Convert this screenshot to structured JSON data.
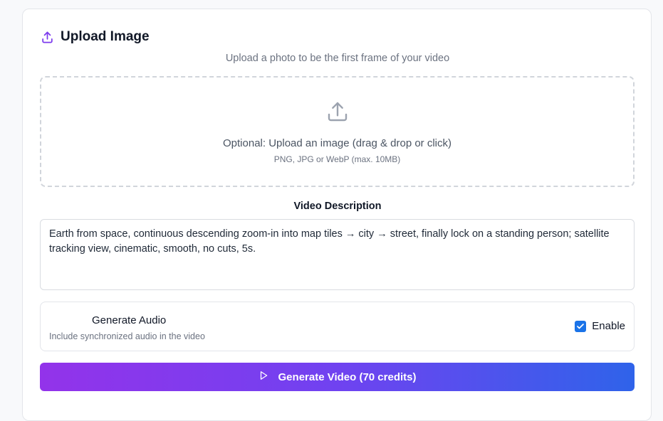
{
  "upload": {
    "title": "Upload Image",
    "subtitle": "Upload a photo to be the first frame of your video",
    "dropzone_text": "Optional: Upload an image (drag & drop or click)",
    "dropzone_hint": "PNG, JPG or WebP (max. 10MB)",
    "icon": "upload-icon"
  },
  "description": {
    "label": "Video Description",
    "value": "Earth from space, continuous descending zoom-in into map tiles → city → street, finally lock on a standing person; satellite tracking view, cinematic, smooth, no cuts, 5s."
  },
  "audio": {
    "title": "Generate Audio",
    "subtitle": "Include synchronized audio in the video",
    "enable_label": "Enable",
    "enabled": true
  },
  "generate_button": {
    "label": "Generate Video (70 credits)",
    "icon": "play-icon"
  },
  "colors": {
    "accent_purple": "#9333ea",
    "accent_blue": "#2f63ea",
    "checkbox_blue": "#1a73e8"
  }
}
